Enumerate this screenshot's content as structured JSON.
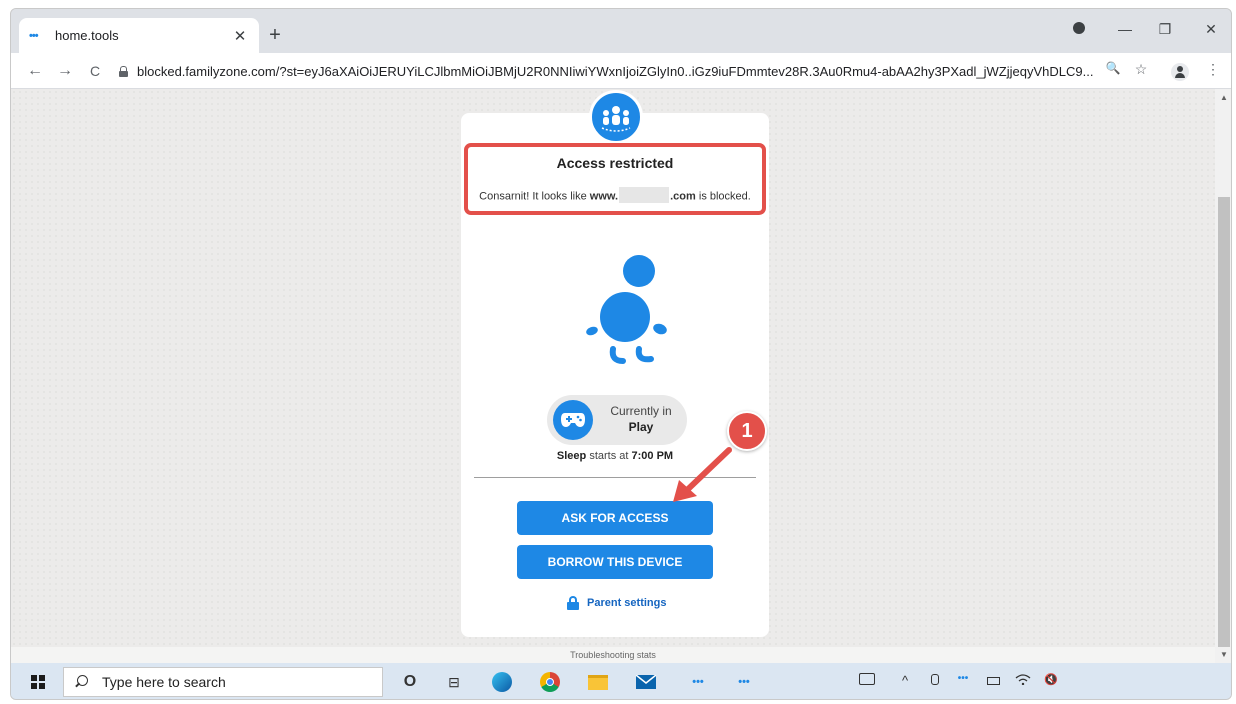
{
  "browser": {
    "tab_title": "home.tools",
    "tab_close": "✕",
    "new_tab": "+",
    "url": "blocked.familyzone.com/?st=eyJ6aXAiOiJERUYiLCJlbmMiOiJBMjU2R0NNIiwiYWxnIjoiZGlyIn0..iGz9iuFDmmtev28R.3Au0Rmu4-abAA2hy3PXadl_jWZjjeqyVhDLC9...",
    "controls": {
      "minimize": "—",
      "restore": "❐",
      "close": "✕"
    },
    "nav": {
      "back": "←",
      "forward": "→",
      "reload": "C"
    },
    "toolbar_icons": {
      "zoom": "🔍",
      "bookmark": "☆",
      "menu": "⋮"
    }
  },
  "page": {
    "title": "Access restricted",
    "blocked_prefix": "Consarnit! It looks like ",
    "blocked_domain_start": "www.",
    "blocked_domain_end": ".com",
    "blocked_suffix": " is blocked.",
    "mode_label": "Currently in",
    "mode_value": "Play",
    "sleep_label": "Sleep",
    "sleep_text": " starts at ",
    "sleep_time": "7:00 PM",
    "ask_button": "ASK FOR ACCESS",
    "borrow_button": "BORROW THIS DEVICE",
    "parent_settings": "Parent settings",
    "troubleshooting": "Troubleshooting stats",
    "annotation_number": "1"
  },
  "taskbar": {
    "search_placeholder": "Type here to search",
    "cortana": "O",
    "task_view": "⊟",
    "tray_chevron": "^",
    "volume": "🔇"
  },
  "colors": {
    "brand": "#1e88e5",
    "annotation": "#e3504a"
  }
}
